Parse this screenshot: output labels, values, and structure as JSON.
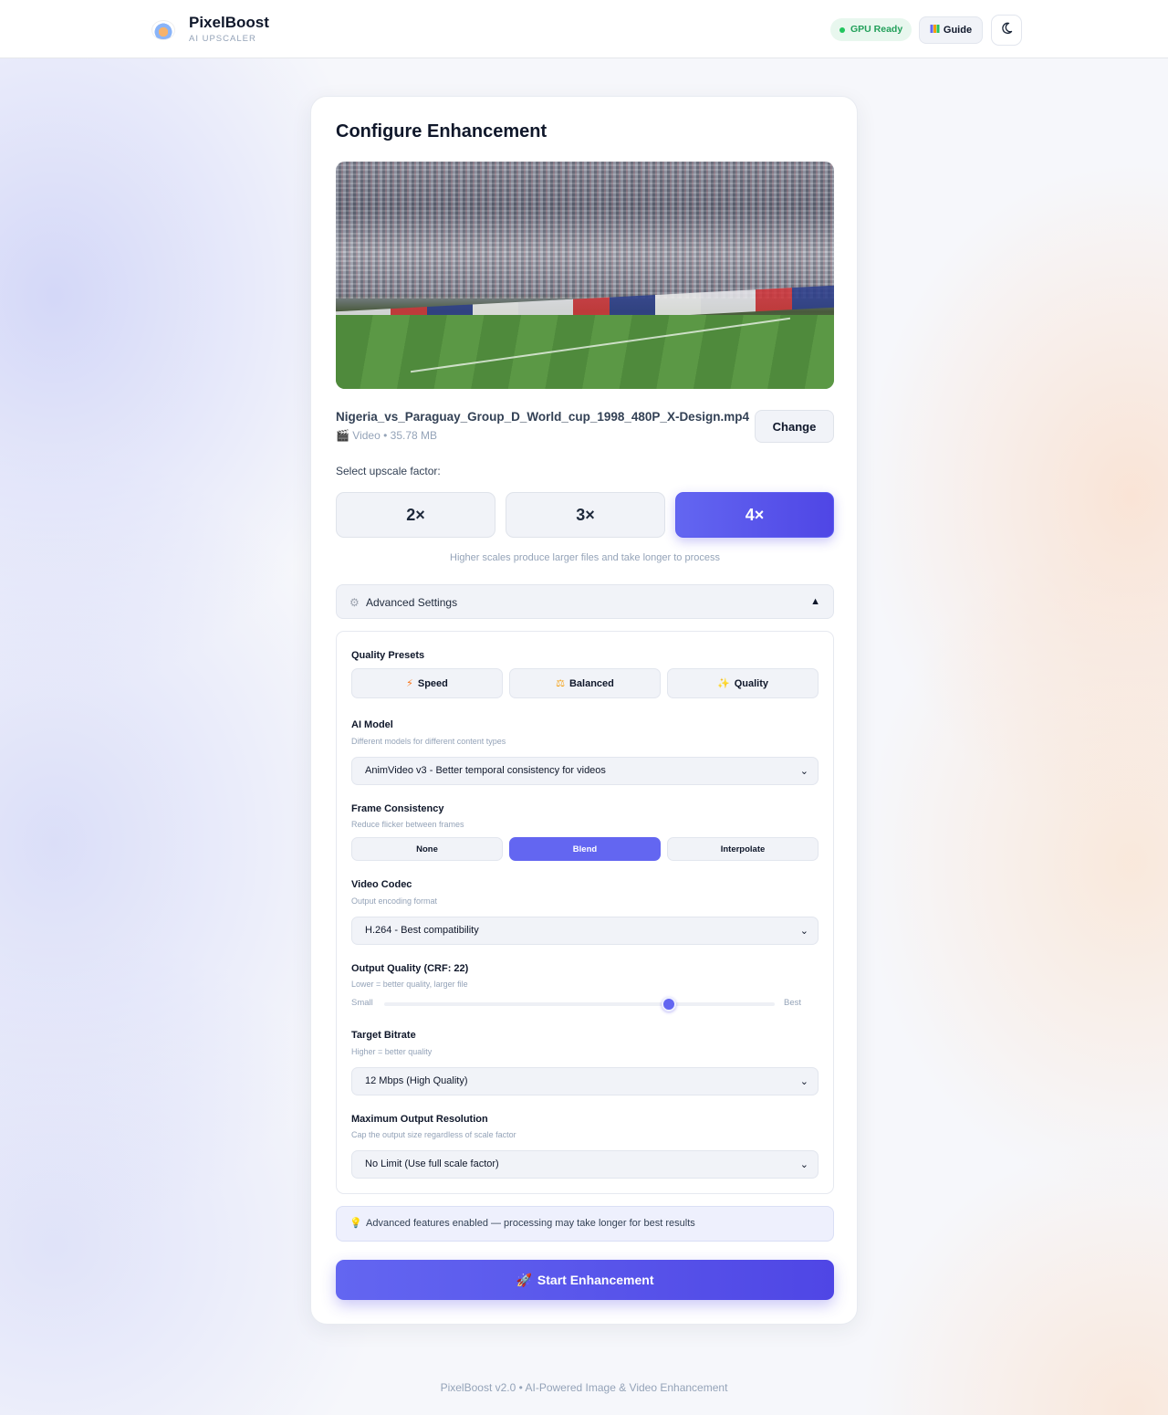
{
  "header": {
    "brand_name": "PixelBoost",
    "brand_sub": "AI UPSCALER",
    "status_badge": "GPU Ready",
    "guide_label": "Guide"
  },
  "config": {
    "title": "Configure Enhancement",
    "file_name": "Nigeria_vs_Paraguay_Group_D_World_cup_1998_480P_X-Design.mp4",
    "file_meta": "Video • 35.78 MB",
    "change_label": "Change",
    "scale_label": "Select upscale factor:",
    "scale_options": [
      "2×",
      "3×",
      "4×"
    ],
    "scale_selected": "4×",
    "scale_hint": "Higher scales produce larger files and take longer to process"
  },
  "advanced": {
    "toggle_label": "Advanced Settings",
    "presets": {
      "title": "Quality Presets",
      "options": [
        "Speed",
        "Balanced",
        "Quality"
      ]
    },
    "ai_model": {
      "title": "AI Model",
      "subtitle": "Different models for different content types",
      "value": "AnimVideo v3 - Better temporal consistency for videos"
    },
    "frame_consistency": {
      "title": "Frame Consistency",
      "subtitle": "Reduce flicker between frames",
      "options": [
        "None",
        "Blend",
        "Interpolate"
      ],
      "selected": "Blend"
    },
    "video_codec": {
      "title": "Video Codec",
      "subtitle": "Output encoding format",
      "value": "H.264 - Best compatibility"
    },
    "output_quality": {
      "title": "Output Quality (CRF: 22)",
      "subtitle": "Lower = better quality, larger file",
      "min_label": "Small",
      "max_label": "Best",
      "level": 0.73
    },
    "target_bitrate": {
      "title": "Target Bitrate",
      "subtitle": "Higher = better quality",
      "value": "12 Mbps (High Quality)"
    },
    "max_resolution": {
      "title": "Maximum Output Resolution",
      "subtitle": "Cap the output size regardless of scale factor",
      "value": "No Limit (Use full scale factor)"
    }
  },
  "notice": "Advanced features enabled — processing may take longer for best results",
  "start_label": "Start Enhancement",
  "footer": "PixelBoost v2.0 • AI-Powered Image & Video Enhancement",
  "colors": {
    "accent": "#6366f1",
    "accent_dark": "#4f46e5",
    "status_green": "#22c55e"
  }
}
